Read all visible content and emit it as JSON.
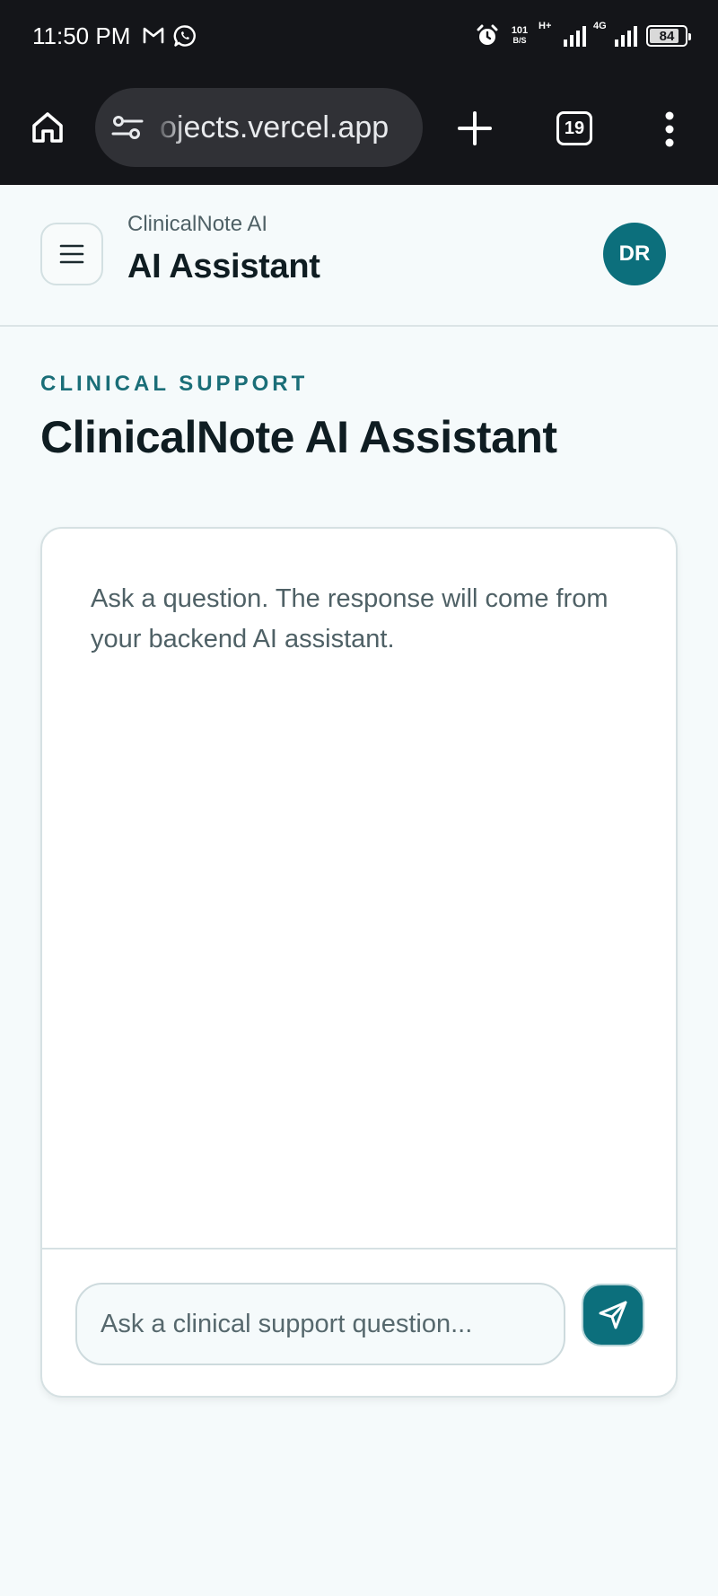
{
  "status_bar": {
    "time": "11:50 PM",
    "net_speed_value": "101",
    "net_speed_unit": "B/S",
    "network_h": "H+",
    "network_4g": "4G",
    "battery_level": "84",
    "battery_fraction": 0.84
  },
  "browser": {
    "url_visible": "ojects.vercel.app",
    "tab_count": "19"
  },
  "header": {
    "app_name": "ClinicalNote AI",
    "title": "AI Assistant",
    "avatar_initials": "DR"
  },
  "page": {
    "eyebrow": "CLINICAL SUPPORT",
    "title": "ClinicalNote AI Assistant"
  },
  "chat": {
    "intro_message": "Ask a question. The response will come from your backend AI assistant.",
    "input_value": "",
    "input_placeholder": "Ask a clinical support question..."
  },
  "colors": {
    "accent": "#0c6f7c",
    "background": "#f5fafb",
    "system_bar": "#141519"
  },
  "icons": [
    "gmail-icon",
    "whatsapp-icon",
    "alarm-icon",
    "home-icon",
    "site-settings-icon",
    "plus-icon",
    "more-vert-icon",
    "hamburger-menu-icon",
    "send-icon"
  ]
}
